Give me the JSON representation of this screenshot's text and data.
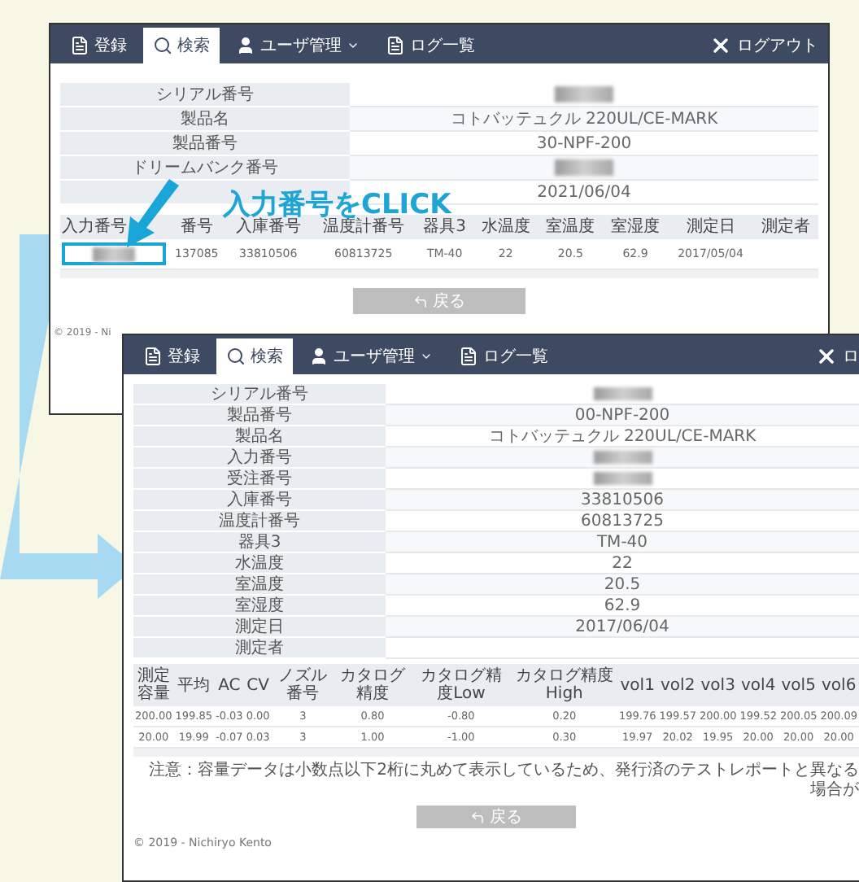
{
  "annotation": {
    "text": "入力番号をCLICK"
  },
  "windows": [
    {
      "nav": {
        "tabs": [
          {
            "kind": "document",
            "label": "登録",
            "selected": false
          },
          {
            "kind": "search",
            "label": "検索",
            "selected": true
          },
          {
            "kind": "user",
            "label": "ユーザ管理",
            "selected": false,
            "dropdown": true
          },
          {
            "kind": "document",
            "label": "ログ一覧",
            "selected": false
          }
        ],
        "logout": "ログアウト"
      },
      "detail_rows": [
        {
          "label": "シリアル番号",
          "blurred": true
        },
        {
          "label": "製品名",
          "value": "コトバッテュクル 220UL/CE-MARK",
          "blurred": false
        },
        {
          "label": "製品番号",
          "value": "30-NPF-200",
          "blurred": false
        },
        {
          "label": "ドリームバンク番号",
          "blurred": true
        },
        {
          "value": "2021/06/04",
          "blurred": false
        }
      ],
      "table": {
        "columns": [
          "入力番号",
          "番号",
          "入庫番号",
          "温度計番号",
          "器具3",
          "水温度",
          "室温度",
          "室湿度",
          "測定日",
          "測定者"
        ],
        "rows": [
          {
            "cells": [
              {
                "blurred": true,
                "highlighted": true
              },
              {
                "text": "137085",
                "blurred": false,
                "highlighted": false
              },
              {
                "text": "33810506",
                "blurred": false,
                "highlighted": false
              },
              {
                "text": "60813725",
                "blurred": false,
                "highlighted": false
              },
              {
                "text": "TM-40",
                "blurred": false,
                "highlighted": false
              },
              {
                "text": "22",
                "blurred": false,
                "highlighted": false
              },
              {
                "text": "20.5",
                "blurred": false,
                "highlighted": false
              },
              {
                "text": "62.9",
                "blurred": false,
                "highlighted": false
              },
              {
                "text": "2017/05/04",
                "blurred": false,
                "highlighted": false
              },
              {
                "blurred": false,
                "highlighted": false
              }
            ]
          }
        ]
      },
      "back_button": "戻る",
      "footer": "© 2019 - Ni"
    },
    {
      "nav": {
        "tabs": [
          {
            "kind": "document",
            "label": "登録",
            "selected": false
          },
          {
            "kind": "search",
            "label": "検索",
            "selected": true
          },
          {
            "kind": "user",
            "label": "ユーザ管理",
            "selected": false,
            "dropdown": true
          },
          {
            "kind": "document",
            "label": "ログ一覧",
            "selected": false
          }
        ],
        "logout": "ロ"
      },
      "detail_rows": [
        {
          "label": "シリアル番号",
          "blurred": true
        },
        {
          "label": "製品番号",
          "value": "00-NPF-200",
          "blurred": false
        },
        {
          "label": "製品名",
          "value": "コトバッテュクル 220UL/CE-MARK",
          "blurred": false
        },
        {
          "label": "入力番号",
          "blurred": true
        },
        {
          "label": "受注番号",
          "blurred": true
        },
        {
          "label": "入庫番号",
          "value": "33810506",
          "blurred": false
        },
        {
          "label": "温度計番号",
          "value": "60813725",
          "blurred": false
        },
        {
          "label": "器具3",
          "value": "TM-40",
          "blurred": false
        },
        {
          "label": "水温度",
          "value": "22",
          "blurred": false
        },
        {
          "label": "室温度",
          "value": "20.5",
          "blurred": false
        },
        {
          "label": "室湿度",
          "value": "62.9",
          "blurred": false
        },
        {
          "label": "測定日",
          "value": "2017/06/04",
          "blurred": false
        },
        {
          "label": "測定者",
          "blurred": false
        }
      ],
      "table": {
        "columns": [
          "測定容量",
          "平均",
          "AC",
          "CV",
          "ノズル番号",
          "カタログ精度",
          "カタログ精度Low",
          "カタログ精度High",
          "vol1",
          "vol2",
          "vol3",
          "vol4",
          "vol5",
          "vol6"
        ],
        "rows": [
          {
            "cells": [
              {
                "text": "200.00"
              },
              {
                "text": "199.85"
              },
              {
                "text": "-0.03"
              },
              {
                "text": "0.00"
              },
              {
                "text": "3"
              },
              {
                "text": "0.80"
              },
              {
                "text": "-0.80"
              },
              {
                "text": "0.20"
              },
              {
                "text": "199.76"
              },
              {
                "text": "199.57"
              },
              {
                "text": "200.00"
              },
              {
                "text": "199.52"
              },
              {
                "text": "200.05"
              },
              {
                "text": "200.09"
              }
            ]
          },
          {
            "cells": [
              {
                "text": "20.00"
              },
              {
                "text": "19.99"
              },
              {
                "text": "-0.07"
              },
              {
                "text": "0.03"
              },
              {
                "text": "3"
              },
              {
                "text": "1.00"
              },
              {
                "text": "-1.00"
              },
              {
                "text": "0.30"
              },
              {
                "text": "19.97"
              },
              {
                "text": "20.02"
              },
              {
                "text": "19.95"
              },
              {
                "text": "20.00"
              },
              {
                "text": "20.00"
              },
              {
                "text": "20.00"
              }
            ]
          }
        ]
      },
      "note": "注意：容量データは小数点以下2桁に丸めて表示しているため、発行済のテストレポートと異なる場合が",
      "back_button": "戻る",
      "footer": "© 2019 - Nichiryo Kento"
    }
  ]
}
